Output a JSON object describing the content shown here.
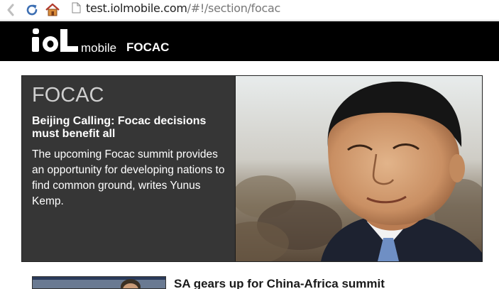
{
  "browser": {
    "url_host": "test.iolmobile.com",
    "url_path": "/#!/section/focac",
    "icons": [
      "back-icon",
      "reload-icon",
      "home-icon",
      "page-icon"
    ]
  },
  "header": {
    "logo": "iol",
    "brand_suffix": "mobile",
    "section": "FOCAC"
  },
  "hero": {
    "section_label": "FOCAC",
    "headline": "Beijing Calling: Focac decisions must benefit all",
    "blurb": "The upcoming Focac summit provides an opportunity for developing nations to find common ground, writes Yunus Kemp."
  },
  "stories": [
    {
      "title": "SA gears up for China-Africa summit"
    }
  ],
  "colors": {
    "header_bg": "#000000",
    "hero_bg": "#363636",
    "hero_section_label": "#cfcfcf"
  }
}
